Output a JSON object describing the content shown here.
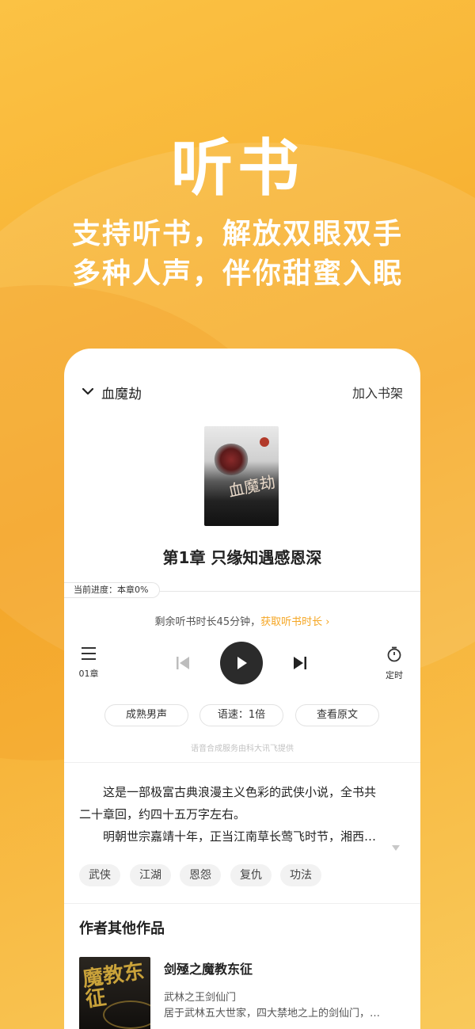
{
  "hero": {
    "title": "听书",
    "subtitle_line1": "支持听书，解放双眼双手",
    "subtitle_line2": "多种人声，伴你甜蜜入眠"
  },
  "player": {
    "book_name": "血魔劫",
    "add_to_shelf": "加入书架",
    "cover_title": "血魔劫",
    "chapter_title": "第1章 只缘知遇感恩深",
    "progress_label": "当前进度：本章0%",
    "remaining_text": "剩余听书时长45分钟，",
    "get_time_link": "获取听书时长 ›",
    "chapter_list_label": "01章",
    "timer_label": "定时",
    "chips": [
      "成熟男声",
      "语速：1倍",
      "查看原文"
    ],
    "credit": "语音合成服务由科大讯飞提供"
  },
  "description": {
    "para1": "这是一部极富古典浪漫主义色彩的武侠小说，全书共二十章回，约四十五万字左右。",
    "para1_line1": "这是一部极富古典浪漫主义色彩的武侠小说，全书共",
    "para1_line2": "二十章回，约四十五万字左右。",
    "para2": "明朝世宗嘉靖十年，正当江南草长莺飞时节，湘西…"
  },
  "tags": [
    "武侠",
    "江湖",
    "恩怨",
    "复仇",
    "功法"
  ],
  "other_works": {
    "section_title": "作者其他作品",
    "items": [
      {
        "title": "剑殛之魔教东征",
        "subtitle": "武林之王剑仙门",
        "desc": "居于武林五大世家，四大禁地之上的剑仙门，…",
        "cover_text": "魔教东征"
      }
    ]
  },
  "colors": {
    "accent": "#f5a623",
    "background": "#f7b83a",
    "play_button": "#2b2b2b"
  }
}
